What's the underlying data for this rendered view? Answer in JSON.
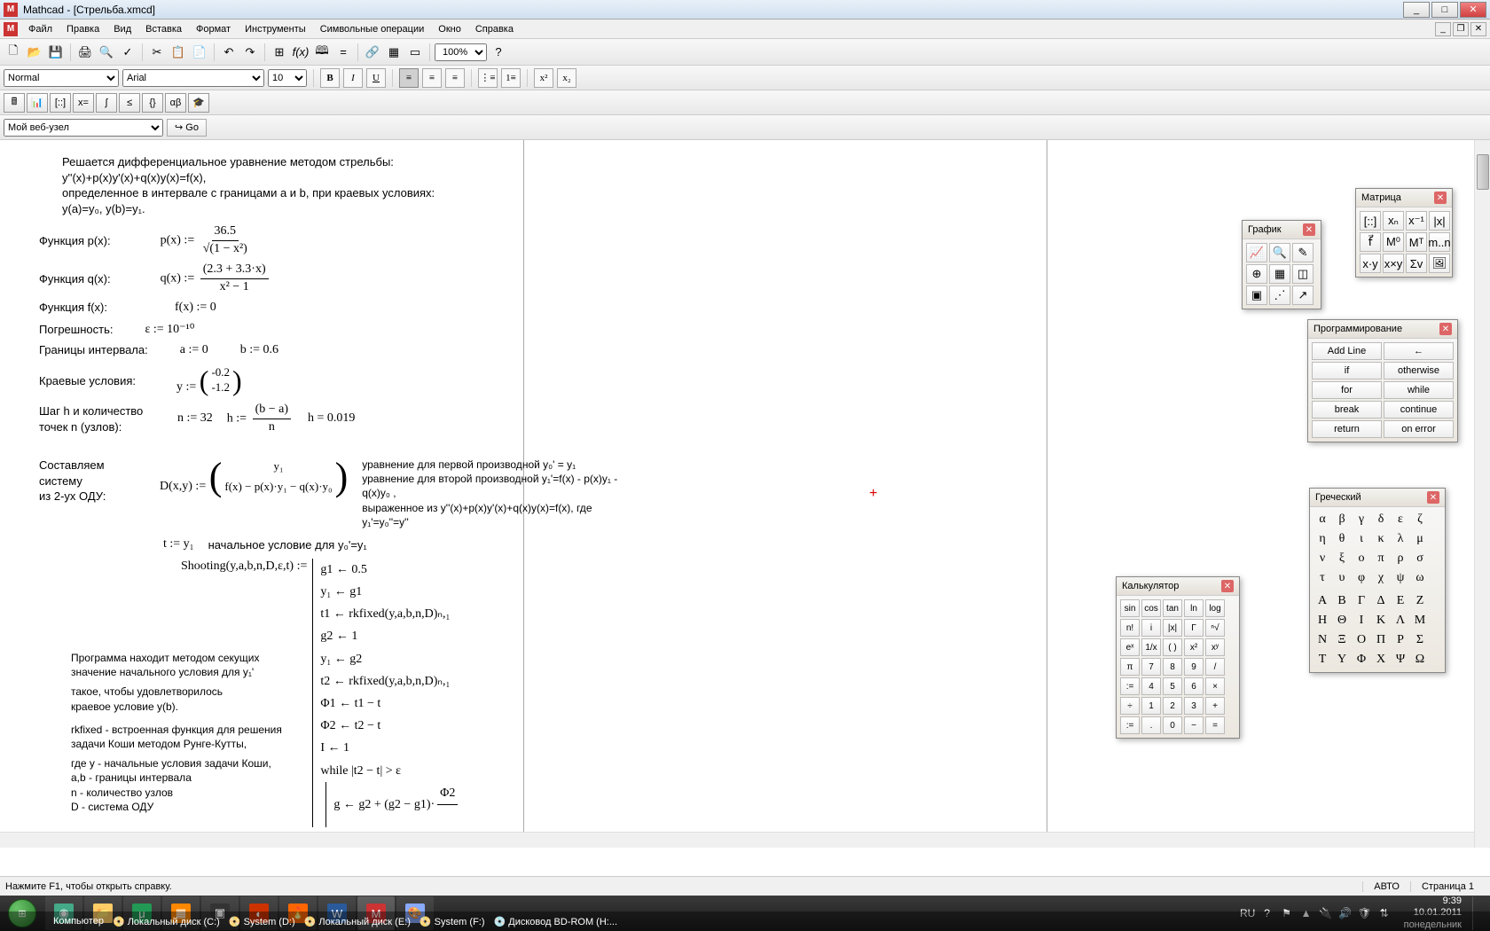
{
  "title": "Mathcad - [Стрельба.xmcd]",
  "menu": [
    "Файл",
    "Правка",
    "Вид",
    "Вставка",
    "Формат",
    "Инструменты",
    "Символьные операции",
    "Окно",
    "Справка"
  ],
  "zoom": "100%",
  "style": "Normal",
  "font": "Arial",
  "size": "10",
  "navSite": "Мой веб-узел",
  "goLabel": "Go",
  "doc": {
    "l1": "Решается дифференциальное уравнение методом стрельбы:",
    "l2": "y''(x)+p(x)y'(x)+q(x)y(x)=f(x),",
    "l3": "определенное в интервале с границами a и b, при краевых условиях:",
    "l4": "y(a)=y₀, y(b)=y₁.",
    "fp": "Функция p(x):",
    "fp_eq": "p(x) :=",
    "fp_num": "36.5",
    "fp_den": "√(1 − x²)",
    "fq": "Функция q(x):",
    "fq_eq": "q(x) :=",
    "fq_num": "(2.3 + 3.3·x)",
    "fq_den": "x² − 1",
    "ff": "Функция f(x):",
    "ff_eq": "f(x) := 0",
    "eps_l": "Погрешность:",
    "eps_eq": "ε := 10⁻¹⁰",
    "bnd": "Границы интервала:",
    "a_eq": "a := 0",
    "b_eq": "b := 0.6",
    "bc": "Краевые условия:",
    "y_eq": "y :=",
    "y0": "-0.2",
    "y1": "-1.2",
    "hn": "Шаг h и количество точек n (узлов):",
    "n_eq": "n := 32",
    "h_eq": "h :=",
    "h_num": "(b − a)",
    "h_den": "n",
    "h_val": "h = 0.019",
    "sys1": "Составляем систему",
    "sys2": "из 2-ух ОДУ:",
    "D_eq": "D(x,y) :=",
    "D_r1": "y₁",
    "D_r2": "f(x) − p(x)·y₁ − q(x)·y₀",
    "eq1": "уравнение для первой производной y₀' = y₁",
    "eq2": "уравнение для второй производной y₁'=f(x) - p(x)y₁ - q(x)y₀ ,",
    "eq3": "выраженное из y''(x)+p(x)y'(x)+q(x)y(x)=f(x), где y₁'=y₀''=y''",
    "t_eq": "t := y₁",
    "t_comm": "начальное условие для y₀'=y₁",
    "shoot": "Shooting(y,a,b,n,D,ε,t) :=",
    "sh1": "g1 ← 0.5",
    "sh2": "y₁ ← g1",
    "sh3": "t1 ← rkfixed(y,a,b,n,D)ₙ,₁",
    "sh4": "g2 ← 1",
    "sh5": "y₁ ← g2",
    "sh6": "t2 ← rkfixed(y,a,b,n,D)ₙ,₁",
    "sh7": "Φ1 ← t1 − t",
    "sh8": "Φ2 ← t2 − t",
    "sh9": "I ← 1",
    "sh10": "while  |t2 − t| > ε",
    "sh11": "g ← g2 + (g2 − g1)·",
    "sh11_frac": "Φ2",
    "p1": "Программа находит методом секущих",
    "p2": "значение начального условия для y₁'",
    "p3": "такое, чтобы удовлетворилось",
    "p4": "краевое условие y(b).",
    "p5": "rkfixed - встроенная функция для решения",
    "p6": "задачи Коши методом Рунге-Кутты,",
    "p7": "где y - начальные условия задачи Коши,",
    "p8": "a,b - границы интервала",
    "p9": "n - количество узлов",
    "p10": "D - система ОДУ"
  },
  "palettes": {
    "graph": {
      "title": "График"
    },
    "matrix": {
      "title": "Матрица"
    },
    "prog": {
      "title": "Программирование",
      "items": [
        "Add Line",
        "←",
        "if",
        "otherwise",
        "for",
        "while",
        "break",
        "continue",
        "return",
        "on error"
      ]
    },
    "calc": {
      "title": "Калькулятор",
      "items": [
        "sin",
        "cos",
        "tan",
        "ln",
        "log",
        "n!",
        "i",
        "|x|",
        "Γ",
        "ⁿ√",
        "eˣ",
        "1/x",
        "( )",
        "x²",
        "xʸ",
        "π",
        "7",
        "8",
        "9",
        "/",
        ":=",
        "4",
        "5",
        "6",
        "×",
        "÷",
        "1",
        "2",
        "3",
        "+",
        ":=",
        ".",
        "0",
        "−",
        "="
      ]
    },
    "greek": {
      "title": "Греческий",
      "lower": [
        "α",
        "β",
        "γ",
        "δ",
        "ε",
        "ζ",
        "η",
        "θ",
        "ι",
        "κ",
        "λ",
        "μ",
        "ν",
        "ξ",
        "ο",
        "π",
        "ρ",
        "σ",
        "τ",
        "υ",
        "φ",
        "χ",
        "ψ",
        "ω"
      ],
      "upper": [
        "Α",
        "Β",
        "Γ",
        "Δ",
        "Ε",
        "Ζ",
        "Η",
        "Θ",
        "Ι",
        "Κ",
        "Λ",
        "Μ",
        "Ν",
        "Ξ",
        "Ο",
        "Π",
        "Ρ",
        "Σ",
        "Τ",
        "Υ",
        "Φ",
        "Χ",
        "Ψ",
        "Ω"
      ]
    }
  },
  "status": {
    "help": "Нажмите F1, чтобы открыть справку.",
    "auto": "АВТО",
    "page": "Страница 1"
  },
  "taskbar": {
    "items": [
      "Компьютер",
      "Локальный диск (C:)",
      "System (D:)",
      "Локальный диск (E:)",
      "System (F:)",
      "Дисковод BD-ROM (H:..."
    ],
    "lang": "RU",
    "time": "9:39",
    "date": "10.01.2011",
    "day": "понедельник"
  }
}
